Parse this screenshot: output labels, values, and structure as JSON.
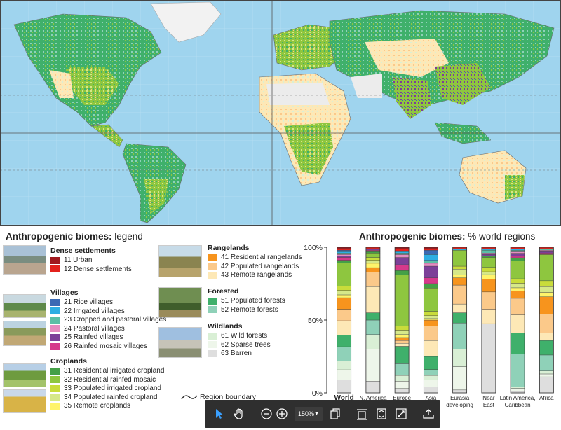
{
  "map_title_prefix": "Anthropogenic biomes:",
  "legend_title_suffix": "legend",
  "chart_title_suffix": "% world regions",
  "region_boundary_label": "Region boundary",
  "legend_groups": [
    {
      "title": "Dense settlements",
      "items": [
        {
          "label": "11 Urban",
          "color": "#a0191e"
        },
        {
          "label": "12 Dense settlements",
          "color": "#e3211c"
        }
      ]
    },
    {
      "title": "Villages",
      "items": [
        {
          "label": "21 Rice villages",
          "color": "#3b6ab4"
        },
        {
          "label": "22 Irrigated villages",
          "color": "#2eaee3"
        },
        {
          "label": "23 Cropped and pastoral villages",
          "color": "#5bbfa6"
        },
        {
          "label": "24 Pastoral villages",
          "color": "#e58cc0"
        },
        {
          "label": "25 Rainfed villages",
          "color": "#7c3f98"
        },
        {
          "label": "26 Rainfed mosaic villages",
          "color": "#d6398b"
        }
      ]
    },
    {
      "title": "Croplands",
      "items": [
        {
          "label": "31 Residential irrigated cropland",
          "color": "#44a047"
        },
        {
          "label": "32 Residential rainfed mosaic",
          "color": "#8ec63f"
        },
        {
          "label": "33 Populated irrigated cropland",
          "color": "#c9dc3b"
        },
        {
          "label": "34 Populated rainfed cropland",
          "color": "#d6e889"
        },
        {
          "label": "35 Remote croplands",
          "color": "#fff46a"
        }
      ]
    },
    {
      "title": "Rangelands",
      "items": [
        {
          "label": "41 Residential rangelands",
          "color": "#f7941d"
        },
        {
          "label": "42 Populated rangelands",
          "color": "#fbc98a"
        },
        {
          "label": "43 Remote rangelands",
          "color": "#fde8b6"
        }
      ]
    },
    {
      "title": "Forested",
      "items": [
        {
          "label": "51 Populated forests",
          "color": "#3fb06b"
        },
        {
          "label": "52 Remote forests",
          "color": "#8fd1b8"
        }
      ]
    },
    {
      "title": "Wildlands",
      "items": [
        {
          "label": "61 Wild forests",
          "color": "#d9efd5"
        },
        {
          "label": "62 Sparse trees",
          "color": "#eef6ea"
        },
        {
          "label": "63 Barren",
          "color": "#dedede"
        }
      ]
    }
  ],
  "chart_data": {
    "type": "bar",
    "stacked": true,
    "yticks": [
      "0%",
      "50%",
      "100%"
    ],
    "ylim": [
      0,
      100
    ],
    "categories": [
      "World",
      "N. America",
      "Europe",
      "Asia",
      "Eurasia developing",
      "Near East",
      "Latin America, Caribbean",
      "Africa"
    ],
    "stack_order_bottom_to_top": [
      "63",
      "62",
      "61",
      "52",
      "51",
      "43",
      "42",
      "41",
      "35",
      "34",
      "33",
      "32",
      "31",
      "26",
      "25",
      "24",
      "23",
      "22",
      "21",
      "12",
      "11"
    ],
    "colors": {
      "11": "#a0191e",
      "12": "#e3211c",
      "21": "#3b6ab4",
      "22": "#2eaee3",
      "23": "#5bbfa6",
      "24": "#e58cc0",
      "25": "#7c3f98",
      "26": "#d6398b",
      "31": "#44a047",
      "32": "#8ec63f",
      "33": "#c9dc3b",
      "34": "#d6e889",
      "35": "#fff46a",
      "41": "#f7941d",
      "42": "#fbc98a",
      "43": "#fde8b6",
      "51": "#3fb06b",
      "52": "#8fd1b8",
      "61": "#d9efd5",
      "62": "#eef6ea",
      "63": "#dedede"
    },
    "values": {
      "World": {
        "63": 9,
        "62": 7,
        "61": 6,
        "52": 10,
        "51": 8,
        "43": 10,
        "42": 8,
        "41": 8,
        "35": 2,
        "34": 3,
        "33": 3,
        "32": 16,
        "31": 2,
        "26": 2,
        "25": 1,
        "24": 1,
        "23": 1,
        "22": 1,
        "21": 1,
        "12": 1,
        "11": 1
      },
      "N. America": {
        "63": 8,
        "62": 22,
        "61": 10,
        "52": 10,
        "51": 5,
        "43": 18,
        "42": 10,
        "41": 3,
        "35": 3,
        "34": 2,
        "33": 2,
        "32": 3,
        "31": 1,
        "26": 1,
        "25": 1,
        "24": 0,
        "23": 0,
        "22": 0,
        "21": 0,
        "12": 1,
        "11": 0
      },
      "Europe": {
        "63": 3,
        "62": 5,
        "61": 4,
        "52": 8,
        "51": 12,
        "43": 2,
        "42": 2,
        "41": 2,
        "35": 2,
        "34": 3,
        "33": 3,
        "32": 35,
        "31": 3,
        "26": 4,
        "25": 5,
        "24": 2,
        "23": 1,
        "22": 1,
        "21": 0,
        "12": 2,
        "11": 1
      },
      "Asia": {
        "63": 4,
        "62": 5,
        "61": 3,
        "52": 4,
        "51": 9,
        "43": 11,
        "42": 10,
        "41": 4,
        "35": 1,
        "34": 2,
        "33": 3,
        "32": 16,
        "31": 3,
        "26": 4,
        "25": 8,
        "24": 2,
        "23": 2,
        "22": 4,
        "21": 3,
        "12": 1,
        "11": 1
      },
      "Eurasia developing": {
        "63": 2,
        "62": 16,
        "61": 12,
        "52": 18,
        "51": 7,
        "43": 6,
        "42": 13,
        "41": 5,
        "35": 2,
        "34": 4,
        "33": 2,
        "32": 11,
        "31": 0,
        "26": 0,
        "25": 0,
        "24": 0,
        "23": 0,
        "22": 1,
        "21": 0,
        "12": 1,
        "11": 0
      },
      "Near East": {
        "63": 48,
        "62": 0,
        "61": 0,
        "52": 0,
        "51": 0,
        "43": 10,
        "42": 12,
        "41": 9,
        "35": 3,
        "34": 2,
        "33": 3,
        "32": 7,
        "31": 1,
        "26": 0,
        "25": 1,
        "24": 1,
        "23": 2,
        "22": 1,
        "21": 0,
        "12": 1,
        "11": 0
      },
      "Latin America, Caribbean": {
        "63": 1,
        "62": 2,
        "61": 1,
        "52": 22,
        "51": 14,
        "43": 12,
        "42": 11,
        "41": 5,
        "35": 2,
        "34": 3,
        "33": 3,
        "32": 12,
        "31": 2,
        "26": 1,
        "25": 2,
        "24": 1,
        "23": 1,
        "22": 1,
        "21": 0,
        "12": 1,
        "11": 0
      },
      "Africa": {
        "63": 11,
        "62": 2,
        "61": 2,
        "52": 11,
        "51": 10,
        "43": 5,
        "42": 13,
        "41": 12,
        "35": 3,
        "34": 4,
        "33": 4,
        "32": 18,
        "31": 0,
        "26": 1,
        "25": 1,
        "24": 1,
        "23": 1,
        "22": 0,
        "21": 0,
        "12": 1,
        "11": 0
      }
    }
  },
  "toolbar": {
    "zoom_value": "150%"
  }
}
